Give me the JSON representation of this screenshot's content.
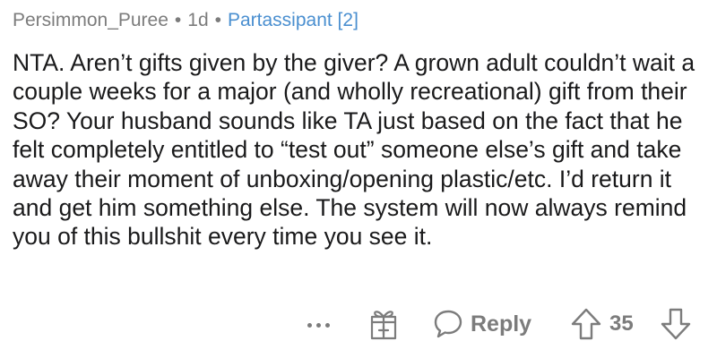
{
  "comment": {
    "author": "Persimmon_Puree",
    "age": "1d",
    "flair": "Partassipant [2]",
    "separator": "•",
    "body": "NTA. Aren’t gifts given by the giver? A grown adult couldn’t wait a couple weeks for a major (and wholly recreational) gift from their SO? Your husband sounds like TA just based on the fact that he felt completely entitled to “test out” someone else’s gift and take away their moment of unboxing/opening plastic/etc. I’d return it and get him something else. The system will now always remind you of this bullshit every time you see it."
  },
  "actions": {
    "more_icon": "ellipsis-icon",
    "award_icon": "gift-icon",
    "reply_icon": "speech-bubble-icon",
    "reply_label": "Reply",
    "upvote_icon": "arrow-up-icon",
    "score": "35",
    "downvote_icon": "arrow-down-icon"
  },
  "colors": {
    "meta_text": "#7c7c7c",
    "flair_text": "#4a8fd0",
    "body_text": "#1a1a1b",
    "icon": "#7c7c7c",
    "background": "#ffffff"
  }
}
